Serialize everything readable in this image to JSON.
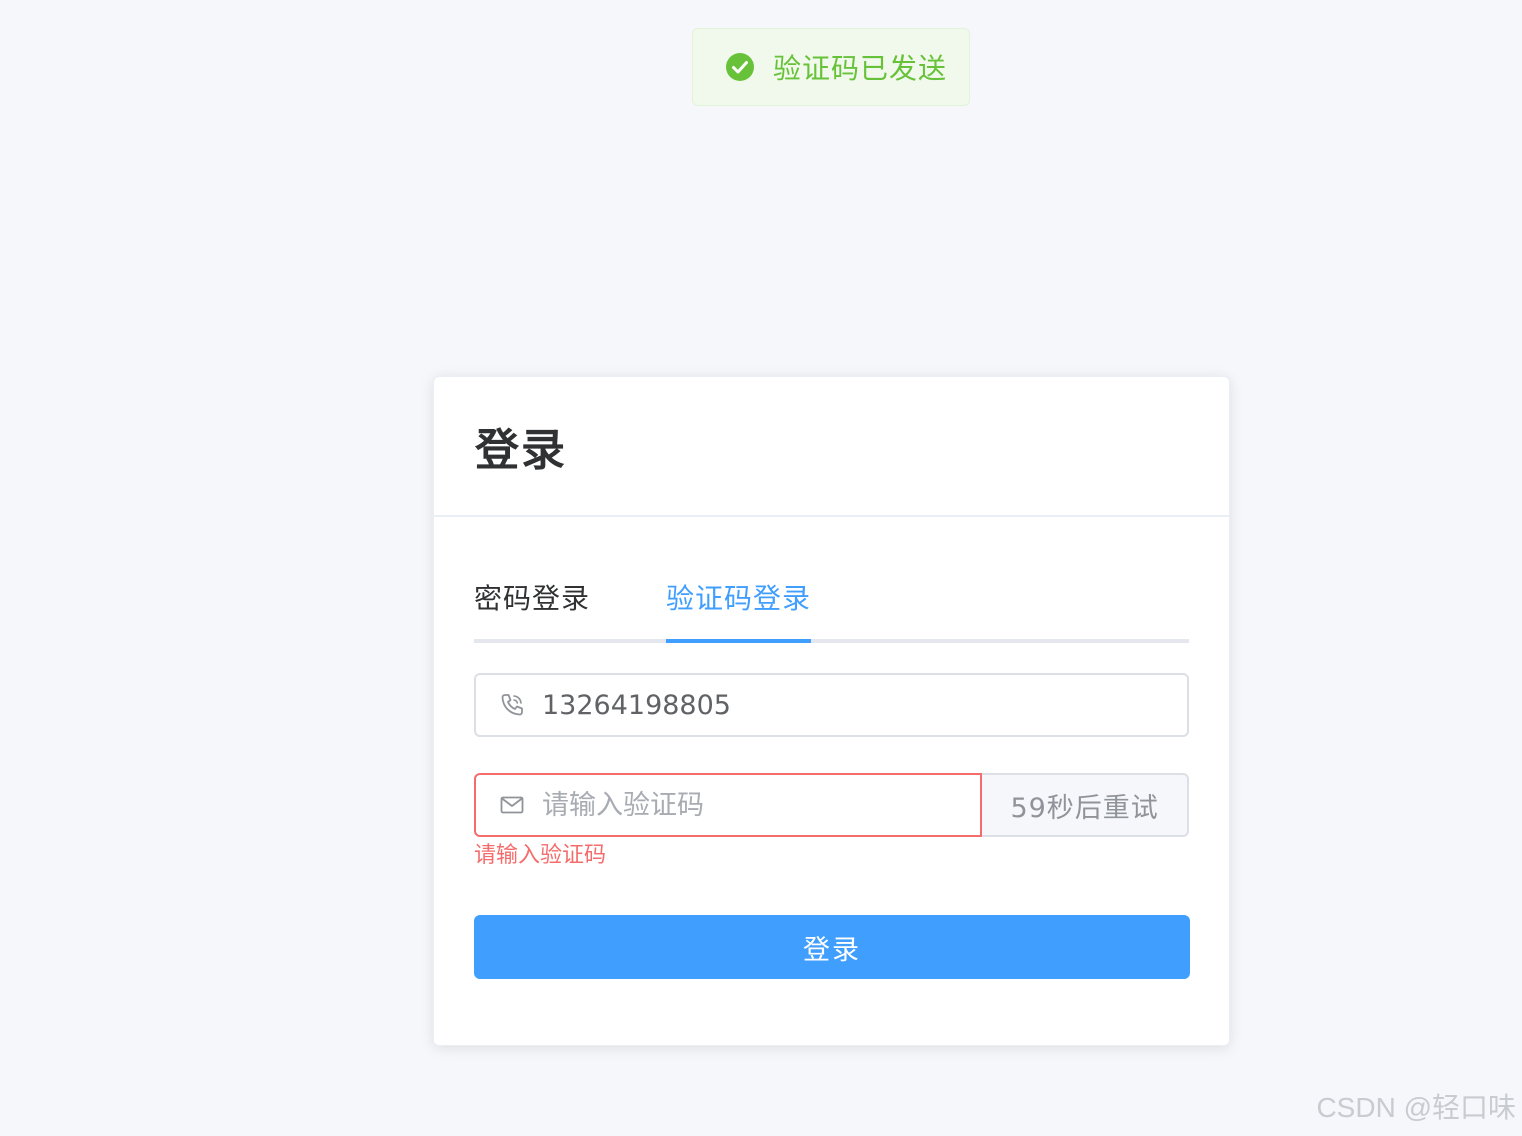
{
  "toast": {
    "icon": "check-circle-icon",
    "message": "验证码已发送"
  },
  "card": {
    "title": "登录",
    "tabs": [
      {
        "label": "密码登录",
        "active": false
      },
      {
        "label": "验证码登录",
        "active": true
      }
    ],
    "phone": {
      "icon": "phone-icon",
      "value": "13264198805"
    },
    "code": {
      "icon": "mail-icon",
      "value": "",
      "placeholder": "请输入验证码",
      "error": "请输入验证码",
      "resend_label": "59秒后重试"
    },
    "submit_label": "登录"
  },
  "watermark": "CSDN @轻口味",
  "colors": {
    "primary": "#409eff",
    "success": "#67c23a",
    "danger": "#f56c6c",
    "background": "#f5f7fa"
  }
}
